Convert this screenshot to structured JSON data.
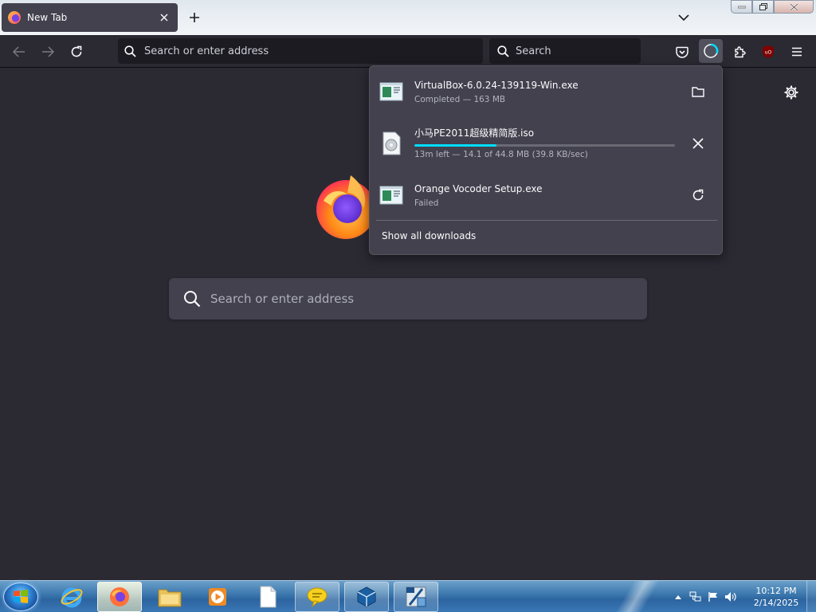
{
  "browser": {
    "tab": {
      "title": "New Tab",
      "favicon": "firefox-icon"
    },
    "new_tab_icon": "plus-icon",
    "tab_list_icon": "chevron-down-icon"
  },
  "window_controls": [
    "minimize-icon",
    "maximize-icon",
    "close-icon"
  ],
  "navbar": {
    "url_placeholder": "Search or enter address",
    "search_placeholder": "Search",
    "toolbar_icons": [
      "pocket-icon",
      "downloads-icon",
      "extensions-icon",
      "ublock-icon",
      "menu-icon"
    ]
  },
  "newtab": {
    "search_placeholder": "Search or enter address"
  },
  "downloads": {
    "items": [
      {
        "name": "VirtualBox-6.0.24-139119-Win.exe",
        "status": "Completed — 163 MB",
        "action": "folder-icon",
        "progress": null
      },
      {
        "name": "小马PE2011超级精简版.iso",
        "status": "13m left — 14.1 of 44.8 MB (39.8 KB/sec)",
        "action": "cancel-icon",
        "progress": 0.315
      },
      {
        "name": "Orange Vocoder Setup.exe",
        "status": "Failed",
        "action": "retry-icon",
        "progress": null
      }
    ],
    "show_all": "Show all downloads",
    "progress_color": "#00ddff"
  },
  "taskbar": {
    "pinned": [
      "internet-explorer-icon",
      "firefox-icon",
      "file-explorer-icon",
      "media-player-icon",
      "notepad-icon",
      "chat-icon",
      "virtualbox-icon",
      "unknown-app-icon"
    ],
    "clock": {
      "time": "10:12 PM",
      "date": "2/14/2025"
    },
    "tray_icons": [
      "tray-expand-icon",
      "network-icon",
      "action-center-flag-icon",
      "volume-icon"
    ]
  }
}
